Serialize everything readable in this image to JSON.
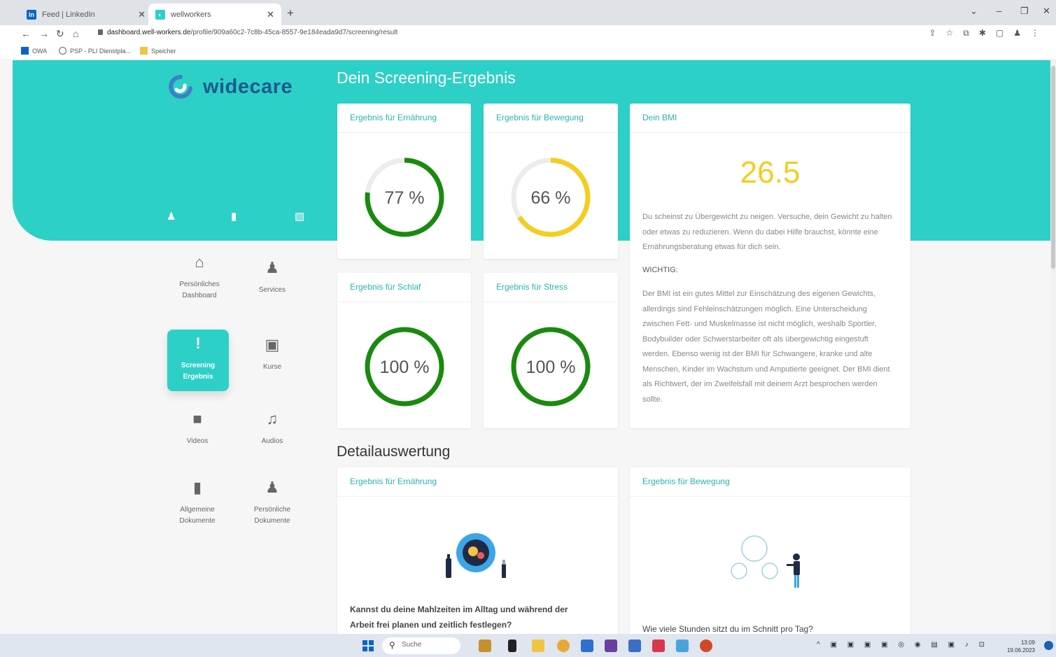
{
  "browser": {
    "tabs": [
      {
        "title": "Feed | LinkedIn",
        "icon": "linkedin-icon",
        "active": false
      },
      {
        "title": "wellworkers",
        "icon": "widecare-icon",
        "active": true
      }
    ],
    "url_host": "dashboard.well-workers.de",
    "url_path": "/profile/909a60c2-7c8b-45ca-8557-9e184eada9d7/screening/result",
    "bookmarks": [
      "OWA",
      "PSP - PLI Dienstpla...",
      "Speicher"
    ]
  },
  "app": {
    "logo_text": "widecare",
    "brand_color": "#2dd0c7",
    "logo_color": "#1b5a8e",
    "page_title": "Dein Screening-Ergebnis",
    "detail_title": "Detailauswertung"
  },
  "sidebar": {
    "items": [
      {
        "label_line1": "Persönliches",
        "label_line2": "Dashboard",
        "icon": "home-icon",
        "active": false
      },
      {
        "label_line1": "Services",
        "label_line2": "",
        "icon": "users-icon",
        "active": false
      },
      {
        "label_line1": "Screening",
        "label_line2": "Ergebnis",
        "icon": "exclamation-icon",
        "active": true
      },
      {
        "label_line1": "Kurse",
        "label_line2": "",
        "icon": "presentation-icon",
        "active": false
      },
      {
        "label_line1": "Videos",
        "label_line2": "",
        "icon": "video-icon",
        "active": false
      },
      {
        "label_line1": "Audios",
        "label_line2": "",
        "icon": "music-icon",
        "active": false
      },
      {
        "label_line1": "Allgemeine",
        "label_line2": "Dokumente",
        "icon": "file-icon",
        "active": false
      },
      {
        "label_line1": "Persönliche",
        "label_line2": "Dokumente",
        "icon": "user-edit-icon",
        "active": false
      }
    ]
  },
  "results": [
    {
      "title": "Ergebnis für Ernährung",
      "percent": 77,
      "label": "77 %",
      "color": "#1a8a0f"
    },
    {
      "title": "Ergebnis für Bewegung",
      "percent": 66,
      "label": "66 %",
      "color": "#f4cd1f"
    },
    {
      "title": "Ergebnis für Schlaf",
      "percent": 100,
      "label": "100 %",
      "color": "#1a8a0f"
    },
    {
      "title": "Ergebnis für Stress",
      "percent": 100,
      "label": "100 %",
      "color": "#1a8a0f"
    }
  ],
  "bmi": {
    "title": "Dein BMI",
    "value": "26.5",
    "value_color": "#f4cd1f",
    "text": "Du scheinst zu Übergewicht zu neigen. Versuche, dein Gewicht zu halten oder etwas zu reduzieren. Wenn du dabei Hilfe brauchst, könnte eine Ernährungsberatung etwas für dich sein.",
    "important_label": "WICHTIG:",
    "important_text": "Der BMI ist ein gutes Mittel zur Einschätzung des eigenen Gewichts, allerdings sind Fehleinschätzungen möglich. Eine Unterscheidung zwischen Fett- und Muskelmasse ist nicht möglich, weshalb Sportler, Bodybuilder oder Schwerstarbeiter oft als übergewichtig eingestuft werden. Ebenso wenig ist der BMI für Schwangere, kranke und alte Menschen, Kinder im Wachstum und Amputierte geeignet. Der BMI dient als Richtwert, der im Zweifelsfall mit deinem Arzt besprochen werden sollte."
  },
  "details": [
    {
      "title": "Ergebnis für Ernährung",
      "question": "Kannst du deine Mahlzeiten im Alltag und während der Arbeit frei planen und zeitlich festlegen?"
    },
    {
      "title": "Ergebnis für Bewegung",
      "question": "Wie viele Stunden sitzt du im Schnitt pro Tag?"
    }
  ],
  "taskbar": {
    "search_placeholder": "Suche",
    "time": "13:09",
    "date": "19.06.2023"
  }
}
